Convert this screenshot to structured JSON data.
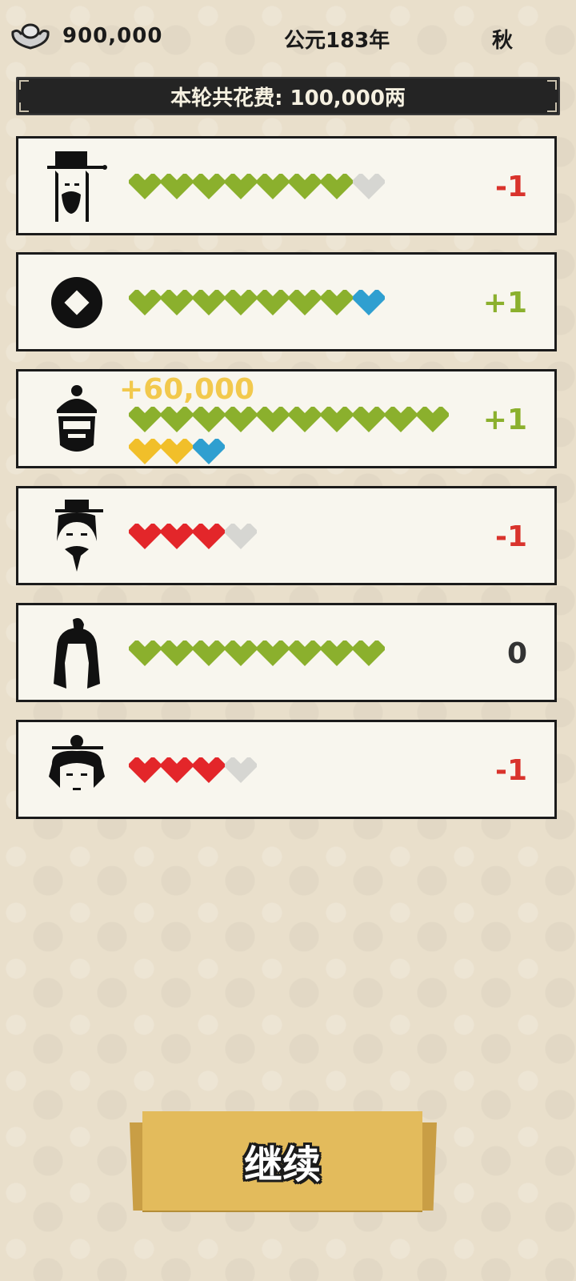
{
  "header": {
    "money": "900,000",
    "year": "公元183年",
    "season": "秋"
  },
  "banner": {
    "spend_text": "本轮共花费: 100,000两"
  },
  "cards": [
    {
      "name": "official",
      "change": "-1",
      "change_type": "neg",
      "hearts": [
        "green",
        "green",
        "green",
        "green",
        "green",
        "green",
        "green",
        "grey"
      ]
    },
    {
      "name": "coin",
      "change": "+1",
      "change_type": "pos",
      "hearts": [
        "green",
        "green",
        "green",
        "green",
        "green",
        "green",
        "green",
        "blue"
      ]
    },
    {
      "name": "merchant",
      "change": "+1",
      "change_type": "pos",
      "floating": "+60,000",
      "hearts": [
        "green",
        "green",
        "green",
        "green",
        "green",
        "green",
        "green",
        "green",
        "green",
        "green",
        "yellow",
        "yellow",
        "blue"
      ]
    },
    {
      "name": "scholar",
      "change": "-1",
      "change_type": "neg",
      "hearts": [
        "red",
        "red",
        "red",
        "grey"
      ]
    },
    {
      "name": "general",
      "change": "0",
      "change_type": "zero",
      "hearts": [
        "green",
        "green",
        "green",
        "green",
        "green",
        "green",
        "green",
        "green"
      ]
    },
    {
      "name": "lady",
      "change": "-1",
      "change_type": "neg",
      "hearts": [
        "red",
        "red",
        "red",
        "grey"
      ]
    }
  ],
  "heart_colors": {
    "green": "#8bb02d",
    "grey": "#d6d6d2",
    "blue": "#2f9fd0",
    "yellow": "#f1bf2a",
    "red": "#e3262a"
  },
  "continue_label": "继续"
}
